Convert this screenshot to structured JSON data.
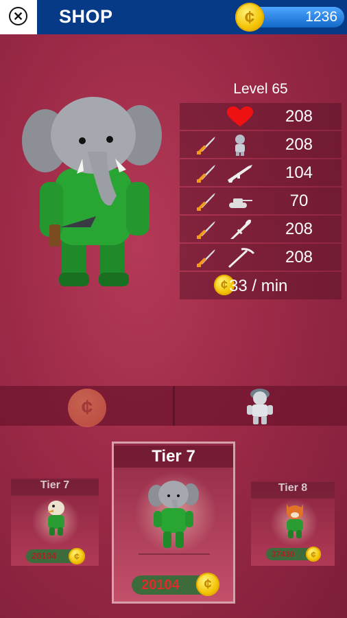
{
  "header": {
    "title": "SHOP",
    "coins": "1236"
  },
  "hero": {
    "level_label": "Level 65",
    "stats": [
      {
        "icon": "heart-icon",
        "value": "208",
        "has_sword": false
      },
      {
        "icon": "soldier-icon",
        "value": "208",
        "has_sword": true
      },
      {
        "icon": "rifle-icon",
        "value": "104",
        "has_sword": true
      },
      {
        "icon": "tank-icon",
        "value": "70",
        "has_sword": true
      },
      {
        "icon": "rocket-launcher-icon",
        "value": "208",
        "has_sword": true
      },
      {
        "icon": "pickaxe-icon",
        "value": "208",
        "has_sword": true
      }
    ],
    "income": "33 / min"
  },
  "tabs": [
    {
      "name": "coin-tab",
      "icon": "coin-icon"
    },
    {
      "name": "soldier-tab",
      "icon": "soldier-icon"
    }
  ],
  "cards": {
    "left": {
      "tier": "Tier 7",
      "price": "20104",
      "character": "eagle"
    },
    "center": {
      "tier": "Tier 7",
      "price": "20104",
      "character": "elephant"
    },
    "right": {
      "tier": "Tier 8",
      "price": "37430",
      "character": "fox"
    }
  },
  "colors": {
    "header": "#063a87",
    "background": "#9c2a47",
    "price_text": "#e12a2a",
    "price_pill": "#3e6b3c",
    "coin": "#f3c200"
  }
}
